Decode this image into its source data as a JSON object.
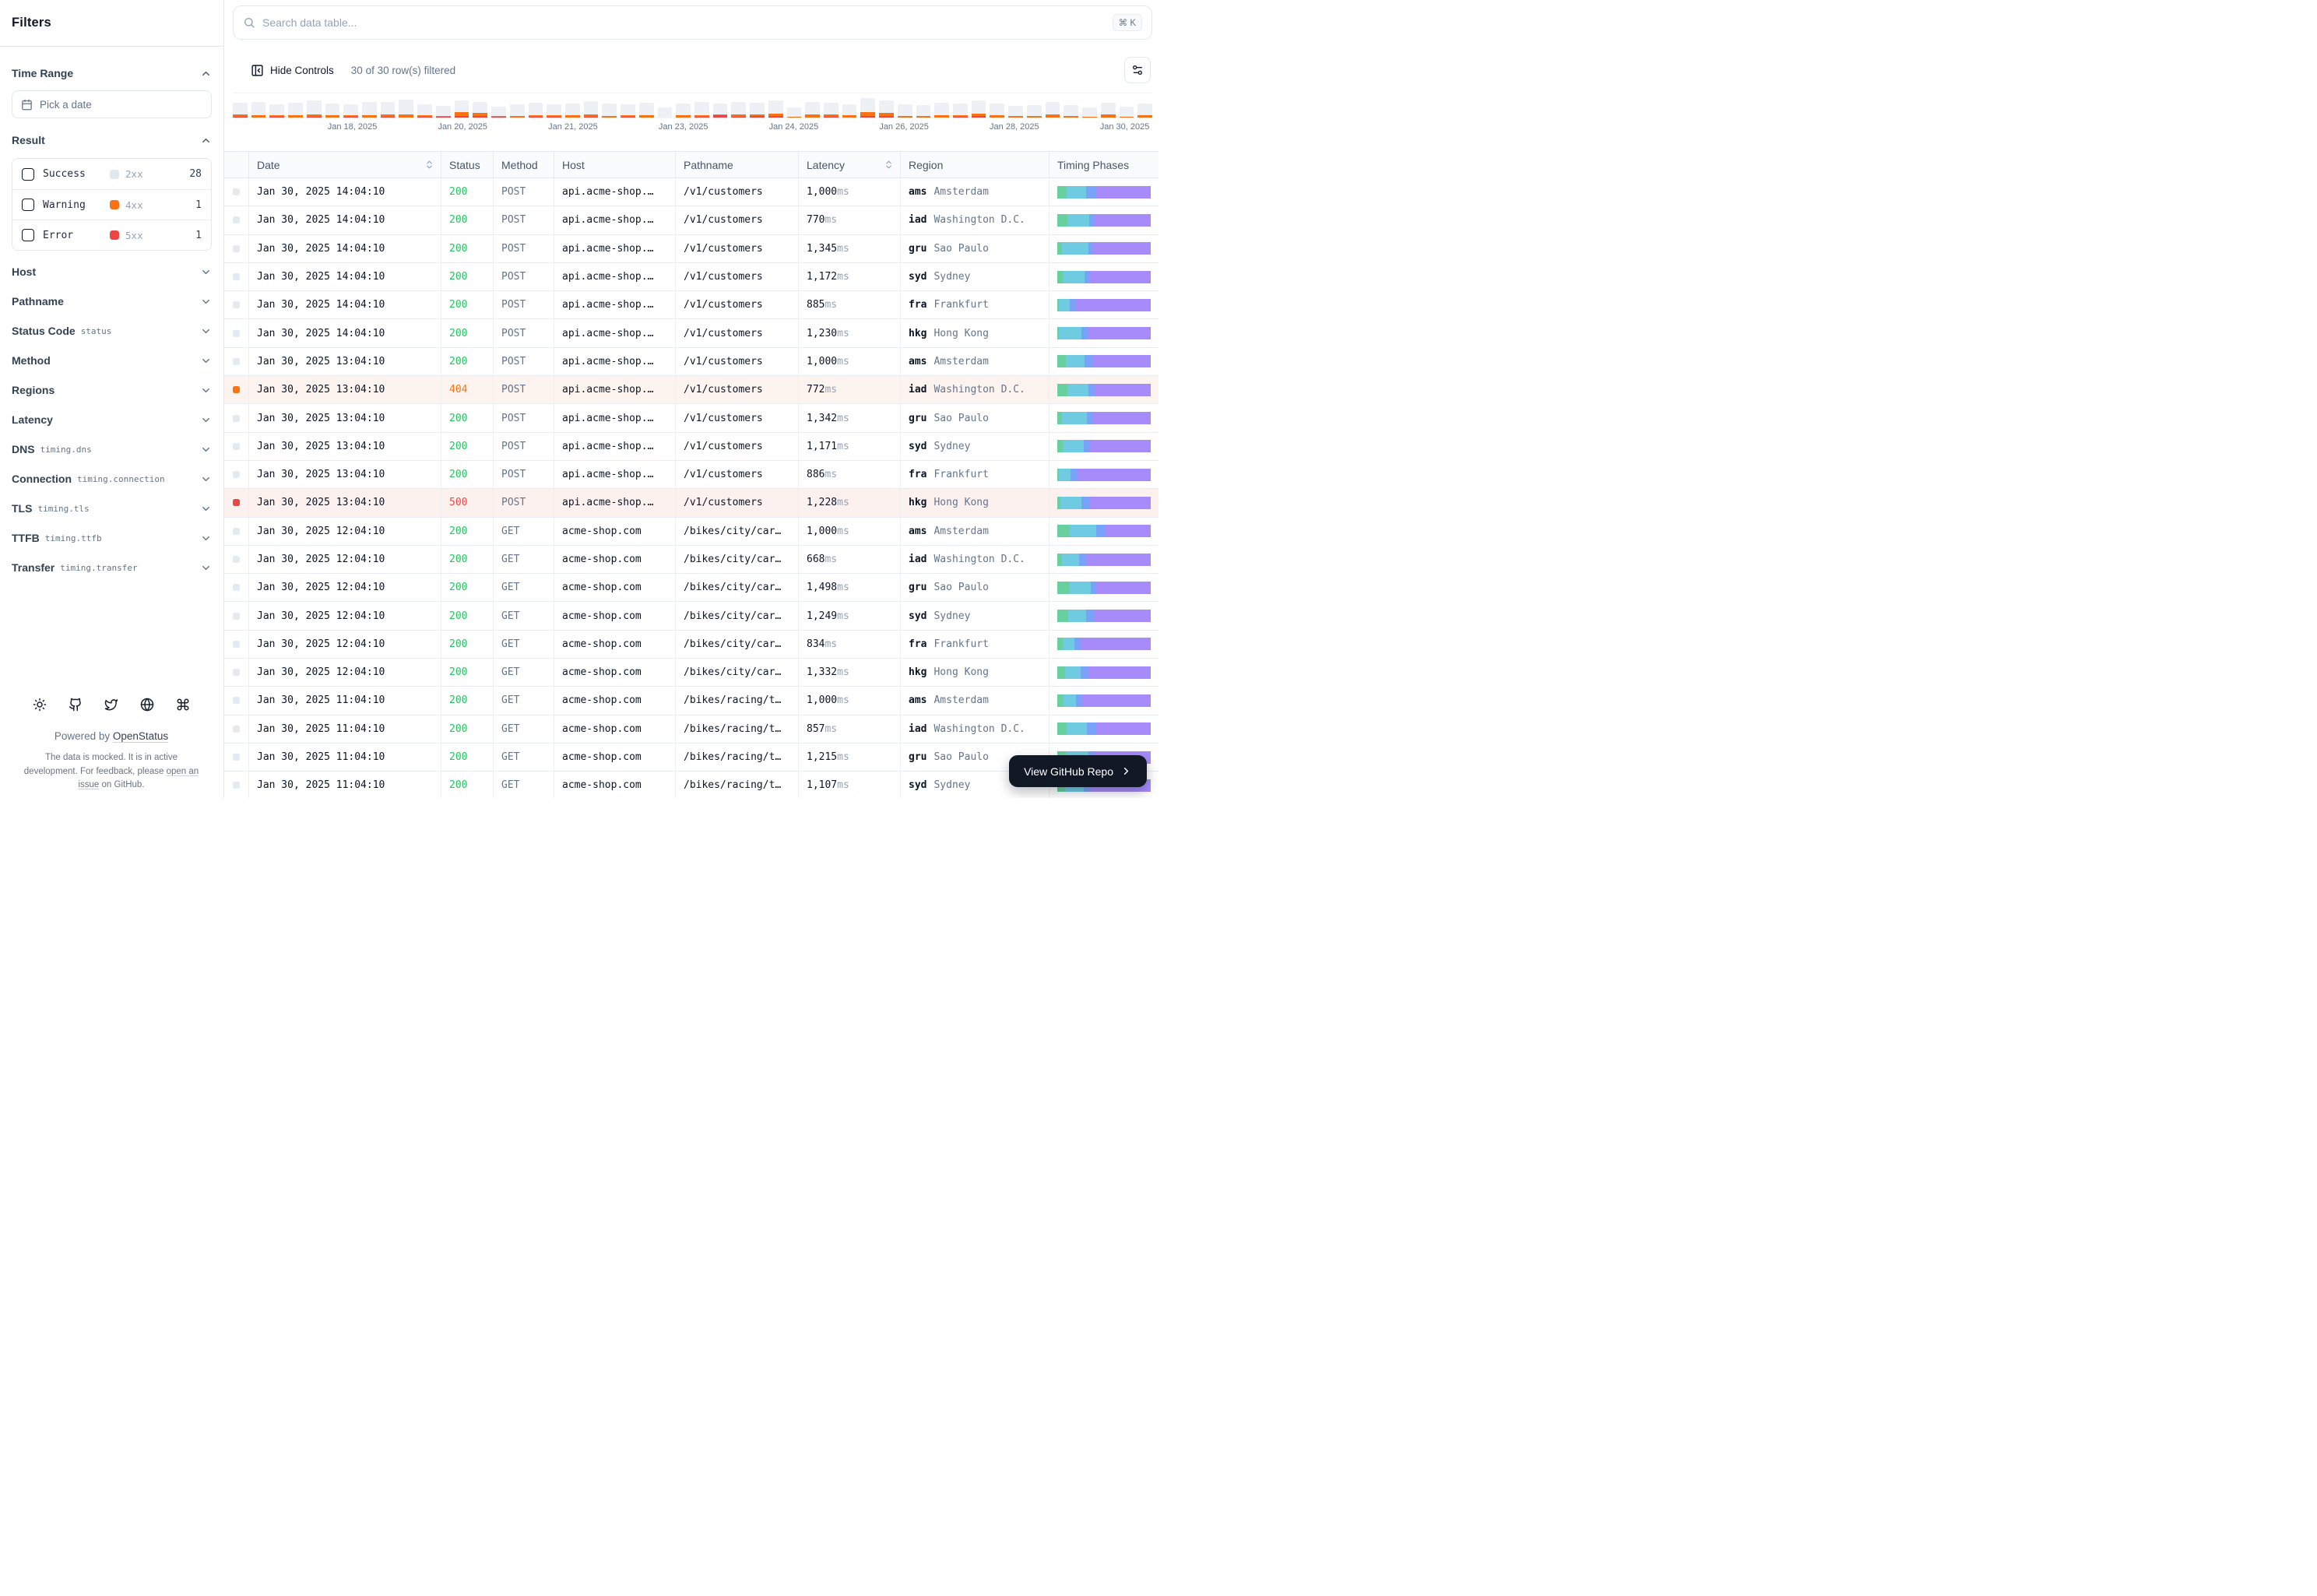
{
  "sidebar": {
    "title": "Filters",
    "time_range": {
      "label": "Time Range",
      "placeholder": "Pick a date"
    },
    "result": {
      "label": "Result",
      "items": [
        {
          "label": "Success",
          "code": "2xx",
          "count": "28",
          "color": "#e2e8f0",
          "level": "success"
        },
        {
          "label": "Warning",
          "code": "4xx",
          "count": "1",
          "color": "#f97316",
          "level": "warning"
        },
        {
          "label": "Error",
          "code": "5xx",
          "count": "1",
          "color": "#ef4444",
          "level": "error"
        }
      ]
    },
    "collapsed_sections": [
      {
        "label": "Host",
        "badge": ""
      },
      {
        "label": "Pathname",
        "badge": ""
      },
      {
        "label": "Status Code",
        "badge": "status"
      },
      {
        "label": "Method",
        "badge": ""
      },
      {
        "label": "Regions",
        "badge": ""
      },
      {
        "label": "Latency",
        "badge": ""
      },
      {
        "label": "DNS",
        "badge": "timing.dns"
      },
      {
        "label": "Connection",
        "badge": "timing.connection"
      },
      {
        "label": "TLS",
        "badge": "timing.tls"
      },
      {
        "label": "TTFB",
        "badge": "timing.ttfb"
      },
      {
        "label": "Transfer",
        "badge": "timing.transfer"
      }
    ],
    "footer": {
      "icons": [
        "sun-icon",
        "github-icon",
        "twitter-icon",
        "globe-icon",
        "command-icon"
      ],
      "powered_prefix": "Powered by ",
      "powered_link": "OpenStatus",
      "disclaimer_prefix": "The data is mocked. It is in active development. For feedback, please ",
      "disclaimer_link": "open an issue",
      "disclaimer_suffix": " on GitHub."
    }
  },
  "toolbar": {
    "search_placeholder": "Search data table...",
    "shortcut": "⌘ K",
    "hide_controls_label": "Hide Controls",
    "filtered_label": "30 of 30 row(s) filtered"
  },
  "chart_data": {
    "type": "bar",
    "stacked": true,
    "title": "Requests over time (success / 4xx / 5xx per time bucket)",
    "x_tick_labels": [
      "Jan 18, 2025",
      "Jan 20, 2025",
      "Jan 21, 2025",
      "Jan 23, 2025",
      "Jan 24, 2025",
      "Jan 26, 2025",
      "Jan 28, 2025",
      "Jan 30, 2025"
    ],
    "tick_positions_pct": [
      13,
      25,
      37,
      49,
      61,
      73,
      85,
      97
    ],
    "series_colors": {
      "success": "#edf1f6",
      "warning": "#f97316",
      "error": "#ef4444"
    },
    "legend": false,
    "bars": [
      {
        "success": 15,
        "warning": 3,
        "error": 1
      },
      {
        "success": 17,
        "warning": 3,
        "error": 0
      },
      {
        "success": 14,
        "warning": 2,
        "error": 1
      },
      {
        "success": 16,
        "warning": 3,
        "error": 0
      },
      {
        "success": 18,
        "warning": 3,
        "error": 1
      },
      {
        "success": 15,
        "warning": 3,
        "error": 0
      },
      {
        "success": 14,
        "warning": 2,
        "error": 1
      },
      {
        "success": 17,
        "warning": 3,
        "error": 0
      },
      {
        "success": 16,
        "warning": 3,
        "error": 1
      },
      {
        "success": 19,
        "warning": 4,
        "error": 0
      },
      {
        "success": 14,
        "warning": 2,
        "error": 1
      },
      {
        "success": 13,
        "warning": 1,
        "error": 1
      },
      {
        "success": 15,
        "warning": 5,
        "error": 2
      },
      {
        "success": 14,
        "warning": 4,
        "error": 2
      },
      {
        "success": 12,
        "warning": 1,
        "error": 1
      },
      {
        "success": 15,
        "warning": 2,
        "error": 0
      },
      {
        "success": 16,
        "warning": 2,
        "error": 1
      },
      {
        "success": 14,
        "warning": 2,
        "error": 1
      },
      {
        "success": 15,
        "warning": 3,
        "error": 0
      },
      {
        "success": 17,
        "warning": 3,
        "error": 1
      },
      {
        "success": 16,
        "warning": 2,
        "error": 0
      },
      {
        "success": 14,
        "warning": 2,
        "error": 1
      },
      {
        "success": 16,
        "warning": 3,
        "error": 0
      },
      {
        "success": 13,
        "warning": 0,
        "error": 0
      },
      {
        "success": 15,
        "warning": 3,
        "error": 0
      },
      {
        "success": 17,
        "warning": 2,
        "error": 1
      },
      {
        "success": 14,
        "warning": 1,
        "error": 3
      },
      {
        "success": 16,
        "warning": 3,
        "error": 1
      },
      {
        "success": 15,
        "warning": 2,
        "error": 2
      },
      {
        "success": 17,
        "warning": 3,
        "error": 2
      },
      {
        "success": 12,
        "warning": 1,
        "error": 0
      },
      {
        "success": 16,
        "warning": 4,
        "error": 0
      },
      {
        "success": 15,
        "warning": 3,
        "error": 1
      },
      {
        "success": 14,
        "warning": 3,
        "error": 0
      },
      {
        "success": 18,
        "warning": 5,
        "error": 2
      },
      {
        "success": 16,
        "warning": 4,
        "error": 2
      },
      {
        "success": 15,
        "warning": 2,
        "error": 0
      },
      {
        "success": 14,
        "warning": 2,
        "error": 0
      },
      {
        "success": 16,
        "warning": 3,
        "error": 0
      },
      {
        "success": 15,
        "warning": 2,
        "error": 1
      },
      {
        "success": 17,
        "warning": 3,
        "error": 2
      },
      {
        "success": 15,
        "warning": 3,
        "error": 0
      },
      {
        "success": 13,
        "warning": 2,
        "error": 0
      },
      {
        "success": 14,
        "warning": 2,
        "error": 0
      },
      {
        "success": 16,
        "warning": 4,
        "error": 0
      },
      {
        "success": 14,
        "warning": 2,
        "error": 0
      },
      {
        "success": 12,
        "warning": 1,
        "error": 0
      },
      {
        "success": 15,
        "warning": 4,
        "error": 0
      },
      {
        "success": 13,
        "warning": 1,
        "error": 0
      },
      {
        "success": 15,
        "warning": 3,
        "error": 0
      }
    ]
  },
  "table": {
    "columns": [
      {
        "label": "Date",
        "sortable": true
      },
      {
        "label": "Status",
        "sortable": false
      },
      {
        "label": "Method",
        "sortable": false
      },
      {
        "label": "Host",
        "sortable": false
      },
      {
        "label": "Pathname",
        "sortable": false
      },
      {
        "label": "Latency",
        "sortable": true
      },
      {
        "label": "Region",
        "sortable": false
      },
      {
        "label": "Timing Phases",
        "sortable": false
      }
    ],
    "latency_unit": "ms",
    "timing_colors": {
      "dns": "#68cf9e",
      "connection": "#6fcbe1",
      "tls": "#78a3f9",
      "ttfb": "#a78bfa"
    },
    "rows": [
      {
        "date": "Jan 30, 2025 14:04:10",
        "status": "200",
        "level": "success",
        "method": "POST",
        "host": "api.acme-shop.…",
        "pathname": "/v1/customers",
        "latency": "1,000",
        "region_code": "ams",
        "region_city": "Amsterdam",
        "timing": [
          10,
          21,
          10,
          59
        ]
      },
      {
        "date": "Jan 30, 2025 14:04:10",
        "status": "200",
        "level": "success",
        "method": "POST",
        "host": "api.acme-shop.…",
        "pathname": "/v1/customers",
        "latency": "770",
        "region_code": "iad",
        "region_city": "Washington D.C.",
        "timing": [
          11,
          23,
          6,
          60
        ]
      },
      {
        "date": "Jan 30, 2025 14:04:10",
        "status": "200",
        "level": "success",
        "method": "POST",
        "host": "api.acme-shop.…",
        "pathname": "/v1/customers",
        "latency": "1,345",
        "region_code": "gru",
        "region_city": "Sao Paulo",
        "timing": [
          5,
          28,
          5,
          62
        ]
      },
      {
        "date": "Jan 30, 2025 14:04:10",
        "status": "200",
        "level": "success",
        "method": "POST",
        "host": "api.acme-shop.…",
        "pathname": "/v1/customers",
        "latency": "1,172",
        "region_code": "syd",
        "region_city": "Sydney",
        "timing": [
          6,
          23,
          6,
          65
        ]
      },
      {
        "date": "Jan 30, 2025 14:04:10",
        "status": "200",
        "level": "success",
        "method": "POST",
        "host": "api.acme-shop.…",
        "pathname": "/v1/customers",
        "latency": "885",
        "region_code": "fra",
        "region_city": "Frankfurt",
        "timing": [
          2,
          11,
          7,
          80
        ]
      },
      {
        "date": "Jan 30, 2025 14:04:10",
        "status": "200",
        "level": "success",
        "method": "POST",
        "host": "api.acme-shop.…",
        "pathname": "/v1/customers",
        "latency": "1,230",
        "region_code": "hkg",
        "region_city": "Hong Kong",
        "timing": [
          2,
          24,
          7,
          67
        ]
      },
      {
        "date": "Jan 30, 2025 13:04:10",
        "status": "200",
        "level": "success",
        "method": "POST",
        "host": "api.acme-shop.…",
        "pathname": "/v1/customers",
        "latency": "1,000",
        "region_code": "ams",
        "region_city": "Amsterdam",
        "timing": [
          9,
          20,
          9,
          62
        ]
      },
      {
        "date": "Jan 30, 2025 13:04:10",
        "status": "404",
        "level": "warning",
        "method": "POST",
        "host": "api.acme-shop.…",
        "pathname": "/v1/customers",
        "latency": "772",
        "region_code": "iad",
        "region_city": "Washington D.C.",
        "timing": [
          11,
          22,
          7,
          60
        ]
      },
      {
        "date": "Jan 30, 2025 13:04:10",
        "status": "200",
        "level": "success",
        "method": "POST",
        "host": "api.acme-shop.…",
        "pathname": "/v1/customers",
        "latency": "1,342",
        "region_code": "gru",
        "region_city": "Sao Paulo",
        "timing": [
          5,
          27,
          6,
          62
        ]
      },
      {
        "date": "Jan 30, 2025 13:04:10",
        "status": "200",
        "level": "success",
        "method": "POST",
        "host": "api.acme-shop.…",
        "pathname": "/v1/customers",
        "latency": "1,171",
        "region_code": "syd",
        "region_city": "Sydney",
        "timing": [
          6,
          22,
          6,
          66
        ]
      },
      {
        "date": "Jan 30, 2025 13:04:10",
        "status": "200",
        "level": "success",
        "method": "POST",
        "host": "api.acme-shop.…",
        "pathname": "/v1/customers",
        "latency": "886",
        "region_code": "fra",
        "region_city": "Frankfurt",
        "timing": [
          2,
          12,
          7,
          79
        ]
      },
      {
        "date": "Jan 30, 2025 13:04:10",
        "status": "500",
        "level": "error",
        "method": "POST",
        "host": "api.acme-shop.…",
        "pathname": "/v1/customers",
        "latency": "1,228",
        "region_code": "hkg",
        "region_city": "Hong Kong",
        "timing": [
          3,
          23,
          8,
          66
        ]
      },
      {
        "date": "Jan 30, 2025 12:04:10",
        "status": "200",
        "level": "success",
        "method": "GET",
        "host": "acme-shop.com",
        "pathname": "/bikes/city/car…",
        "latency": "1,000",
        "region_code": "ams",
        "region_city": "Amsterdam",
        "timing": [
          13,
          29,
          9,
          49
        ]
      },
      {
        "date": "Jan 30, 2025 12:04:10",
        "status": "200",
        "level": "success",
        "method": "GET",
        "host": "acme-shop.com",
        "pathname": "/bikes/city/car…",
        "latency": "668",
        "region_code": "iad",
        "region_city": "Washington D.C.",
        "timing": [
          5,
          18,
          8,
          69
        ]
      },
      {
        "date": "Jan 30, 2025 12:04:10",
        "status": "200",
        "level": "success",
        "method": "GET",
        "host": "acme-shop.com",
        "pathname": "/bikes/city/car…",
        "latency": "1,498",
        "region_code": "gru",
        "region_city": "Sao Paulo",
        "timing": [
          13,
          23,
          5,
          59
        ]
      },
      {
        "date": "Jan 30, 2025 12:04:10",
        "status": "200",
        "level": "success",
        "method": "GET",
        "host": "acme-shop.com",
        "pathname": "/bikes/city/car…",
        "latency": "1,249",
        "region_code": "syd",
        "region_city": "Sydney",
        "timing": [
          12,
          19,
          8,
          61
        ]
      },
      {
        "date": "Jan 30, 2025 12:04:10",
        "status": "200",
        "level": "success",
        "method": "GET",
        "host": "acme-shop.com",
        "pathname": "/bikes/city/car…",
        "latency": "834",
        "region_code": "fra",
        "region_city": "Frankfurt",
        "timing": [
          6,
          12,
          6,
          76
        ]
      },
      {
        "date": "Jan 30, 2025 12:04:10",
        "status": "200",
        "level": "success",
        "method": "GET",
        "host": "acme-shop.com",
        "pathname": "/bikes/city/car…",
        "latency": "1,332",
        "region_code": "hkg",
        "region_city": "Hong Kong",
        "timing": [
          8,
          17,
          8,
          67
        ]
      },
      {
        "date": "Jan 30, 2025 11:04:10",
        "status": "200",
        "level": "success",
        "method": "GET",
        "host": "acme-shop.com",
        "pathname": "/bikes/racing/t…",
        "latency": "1,000",
        "region_code": "ams",
        "region_city": "Amsterdam",
        "timing": [
          7,
          13,
          6,
          74
        ]
      },
      {
        "date": "Jan 30, 2025 11:04:10",
        "status": "200",
        "level": "success",
        "method": "GET",
        "host": "acme-shop.com",
        "pathname": "/bikes/racing/t…",
        "latency": "857",
        "region_code": "iad",
        "region_city": "Washington D.C.",
        "timing": [
          10,
          22,
          9,
          59
        ]
      },
      {
        "date": "Jan 30, 2025 11:04:10",
        "status": "200",
        "level": "success",
        "method": "GET",
        "host": "acme-shop.com",
        "pathname": "/bikes/racing/t…",
        "latency": "1,215",
        "region_code": "gru",
        "region_city": "Sao Paulo",
        "timing": [
          9,
          24,
          7,
          60
        ]
      },
      {
        "date": "Jan 30, 2025 11:04:10",
        "status": "200",
        "level": "success",
        "method": "GET",
        "host": "acme-shop.com",
        "pathname": "/bikes/racing/t…",
        "latency": "1,107",
        "region_code": "syd",
        "region_city": "Sydney",
        "timing": [
          8,
          20,
          7,
          65
        ]
      }
    ]
  },
  "github_button": {
    "label": "View GitHub Repo"
  }
}
